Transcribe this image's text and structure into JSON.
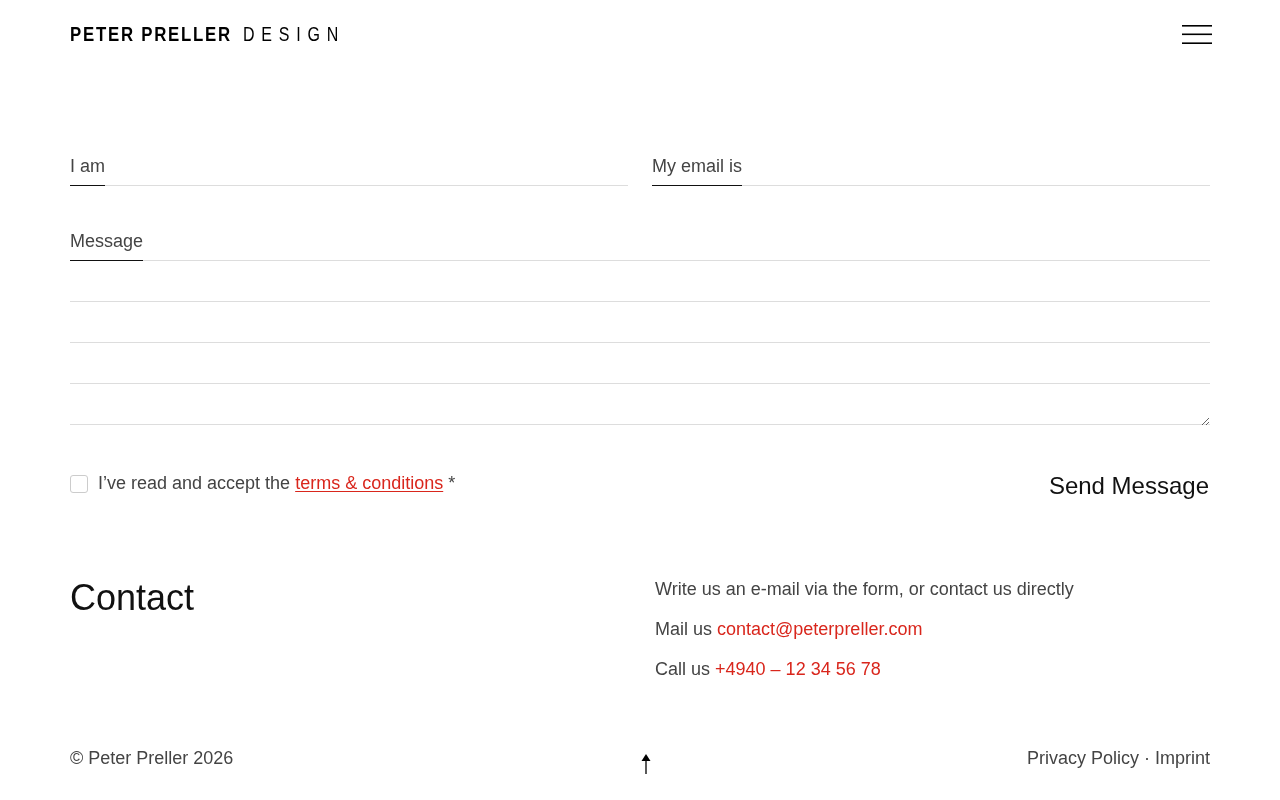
{
  "header": {
    "logo": {
      "name": "PETER PRELLER",
      "suffix": "DESIGN"
    }
  },
  "form": {
    "fields": [
      {
        "label": "I am"
      },
      {
        "label": "My email is"
      }
    ],
    "message": {
      "label": "Message"
    },
    "consent": {
      "checked": false,
      "text": "I’ve read and accept the",
      "link": "terms & conditions",
      "suffix": "*"
    },
    "submit": "Send Message"
  },
  "contact": {
    "title": "Contact",
    "intro": "Write us an e-mail via the form, or contact us directly",
    "lines": [
      {
        "label": "Mail us",
        "link": "contact@peterpreller.com"
      },
      {
        "label": "Call us",
        "link": "+4940 – 12 34 56 78"
      }
    ]
  },
  "footer": {
    "copyright": "© Peter Preller 2026",
    "links": [
      "Privacy Policy",
      "Imprint"
    ],
    "separator": "·"
  }
}
